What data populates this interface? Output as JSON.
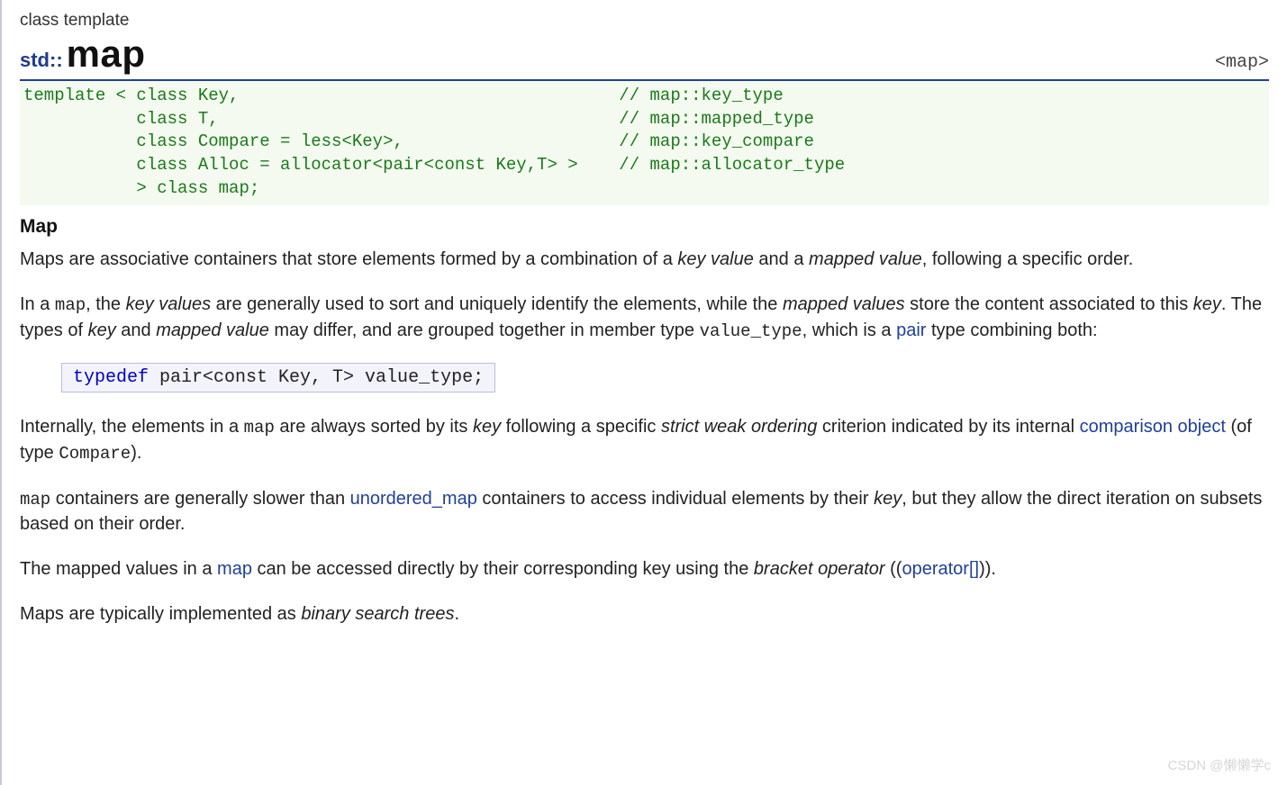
{
  "category": "class template",
  "namespace_prefix": "std::",
  "name": "map",
  "header_tag": "<map>",
  "declaration": "template < class Key,                                     // map::key_type\n           class T,                                       // map::mapped_type\n           class Compare = less<Key>,                     // map::key_compare\n           class Alloc = allocator<pair<const Key,T> >    // map::allocator_type\n           > class map;",
  "section_title": "Map",
  "p1": {
    "t1": "Maps are associative containers that store elements formed by a combination of a ",
    "i1": "key value",
    "t2": " and a ",
    "i2": "mapped value",
    "t3": ", following a specific order."
  },
  "p2": {
    "t1": "In a ",
    "m1": "map",
    "t2": ", the ",
    "i1": "key values",
    "t3": " are generally used to sort and uniquely identify the elements, while the ",
    "i2": "mapped values",
    "t4": " store the content associated to this ",
    "i3": "key",
    "t5": ". The types of ",
    "i4": "key",
    "t6": " and ",
    "i5": "mapped value",
    "t7": " may differ, and are grouped together in member type ",
    "m2": "value_type",
    "t8": ", which is a ",
    "l1": "pair",
    "t9": " type combining both:"
  },
  "typedef": {
    "kw": "typedef",
    "rest": " pair<const Key, T> value_type;"
  },
  "p3": {
    "t1": "Internally, the elements in a ",
    "m1": "map",
    "t2": " are always sorted by its ",
    "i1": "key",
    "t3": " following a specific ",
    "i2": "strict weak ordering",
    "t4": " criterion indicated by its internal ",
    "l1": "comparison object",
    "t5": " (of type ",
    "m2": "Compare",
    "t6": ")."
  },
  "p4": {
    "m1": "map",
    "t1": " containers are generally slower than ",
    "l1": "unordered_map",
    "t2": " containers to access individual elements by their ",
    "i1": "key",
    "t3": ", but they allow the direct iteration on subsets based on their order."
  },
  "p5": {
    "t1": "The mapped values in a ",
    "l1": "map",
    "t2": " can be accessed directly by their corresponding key using the ",
    "i1": "bracket operator",
    "t3": " ((",
    "l2": "operator[]",
    "t4": "))."
  },
  "p6": {
    "t1": "Maps are typically implemented as ",
    "i1": "binary search trees",
    "t2": "."
  },
  "watermark": "CSDN @懒懒学c"
}
